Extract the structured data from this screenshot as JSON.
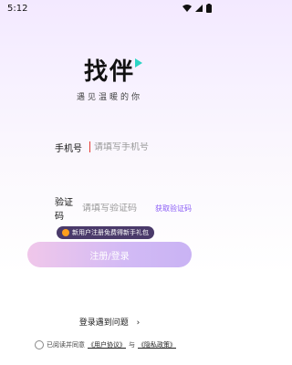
{
  "status": {
    "time": "5:12"
  },
  "logo": {
    "title": "找伴",
    "tagline": "遇见温暖的你"
  },
  "form": {
    "phone_label": "手机号",
    "phone_placeholder": "请填写手机号",
    "code_label": "验证码",
    "code_placeholder": "请填写验证码",
    "get_code": "获取验证码"
  },
  "promo": {
    "text": "新用户注册免费得新手礼包"
  },
  "login": {
    "label": "注册/登录"
  },
  "help": {
    "text": "登录遇到问题",
    "chevron": "›"
  },
  "agreement": {
    "prefix": "已阅读并同意",
    "user_agreement": "《用户协议》",
    "and": "与",
    "privacy_policy": "《隐私政策》"
  },
  "colors": {
    "accent": "#8a5cf6",
    "teal": "#2bd4c4",
    "promo_bg": "#4a3a6a"
  }
}
